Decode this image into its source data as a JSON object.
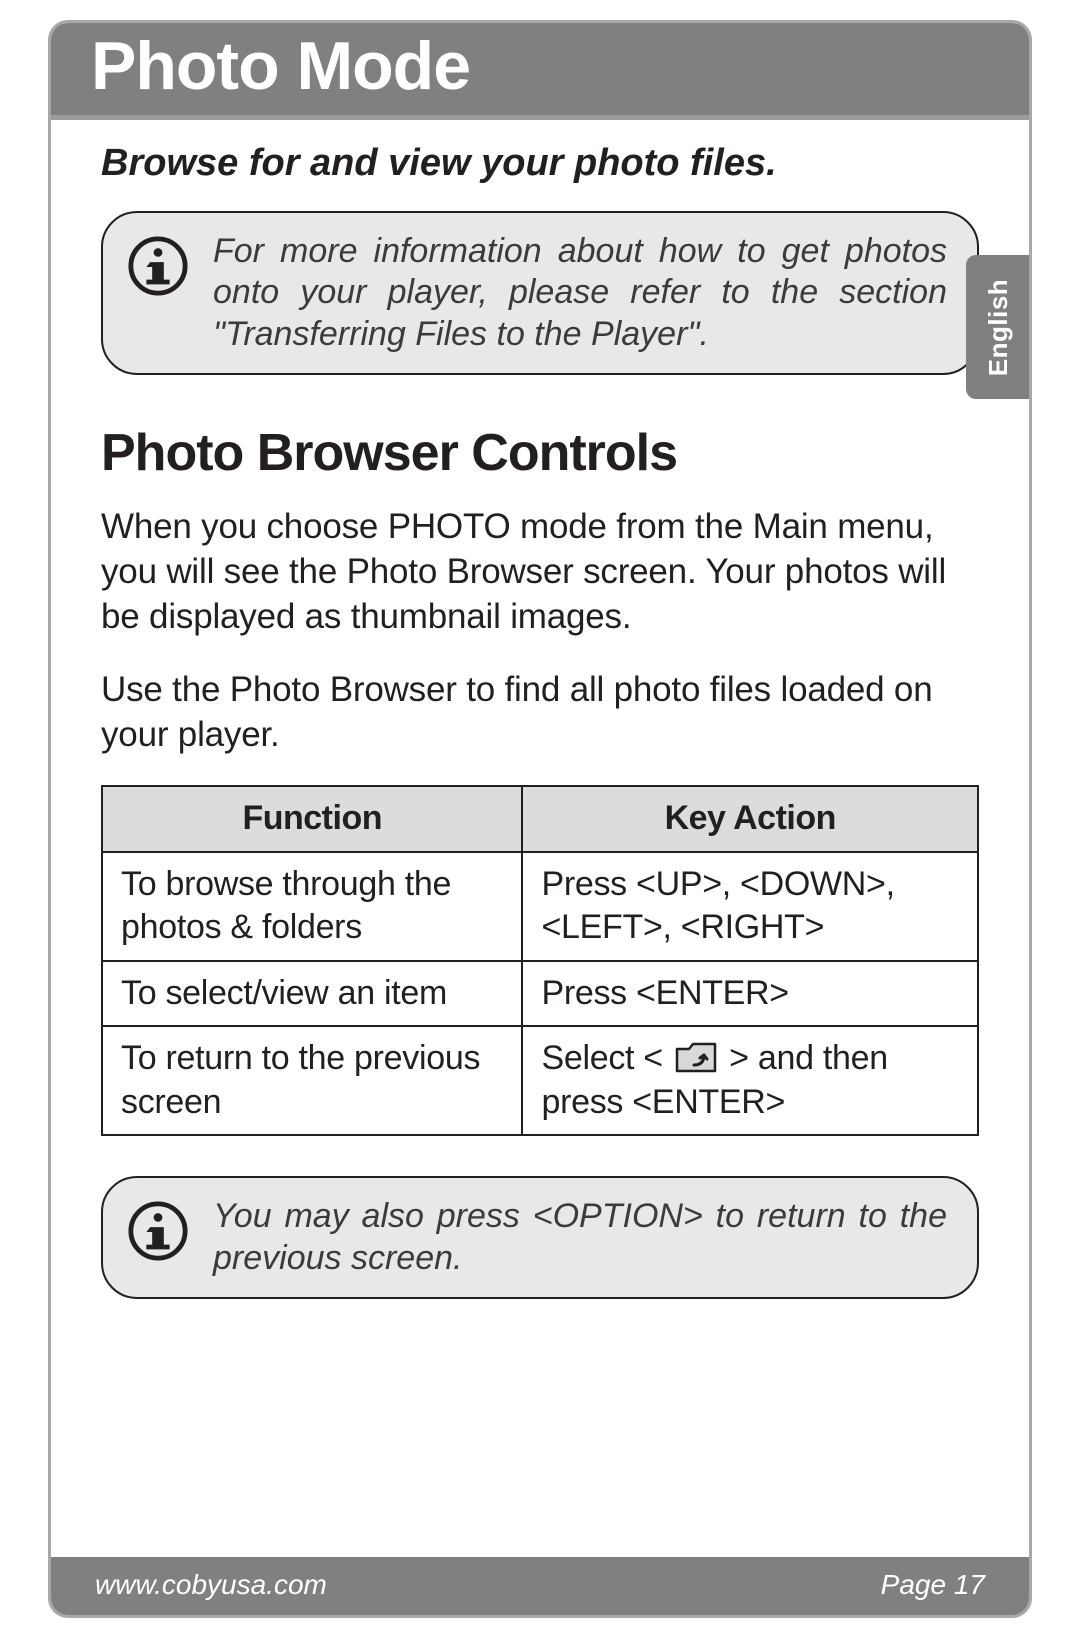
{
  "header": {
    "title": "Photo Mode"
  },
  "subtitle": "Browse for and view your photo files.",
  "info1": "For more information about how to get photos onto your player, please refer to the section \"Transferring Files to the Player\".",
  "section": {
    "title": "Photo Browser Controls",
    "para1": "When you choose PHOTO mode from the Main menu, you will see the Photo Browser screen. Your photos will be displayed as thumbnail images.",
    "para2": "Use the Photo Browser to find all photo files loaded on your player."
  },
  "table": {
    "headers": {
      "col1": "Function",
      "col2": "Key Action"
    },
    "rows": [
      {
        "function": "To browse through the photos & folders",
        "action": "Press <UP>, <DOWN>, <LEFT>, <RIGHT>"
      },
      {
        "function": "To select/view an item",
        "action": "Press <ENTER>"
      },
      {
        "function": "To return to the previous screen",
        "action_pre": "Select < ",
        "action_post": " > and then press <ENTER>"
      }
    ]
  },
  "info2": "You may also press <OPTION> to return to the previous screen.",
  "sidetab": "English",
  "footer": {
    "left": "www.cobyusa.com",
    "right": "Page 17"
  }
}
